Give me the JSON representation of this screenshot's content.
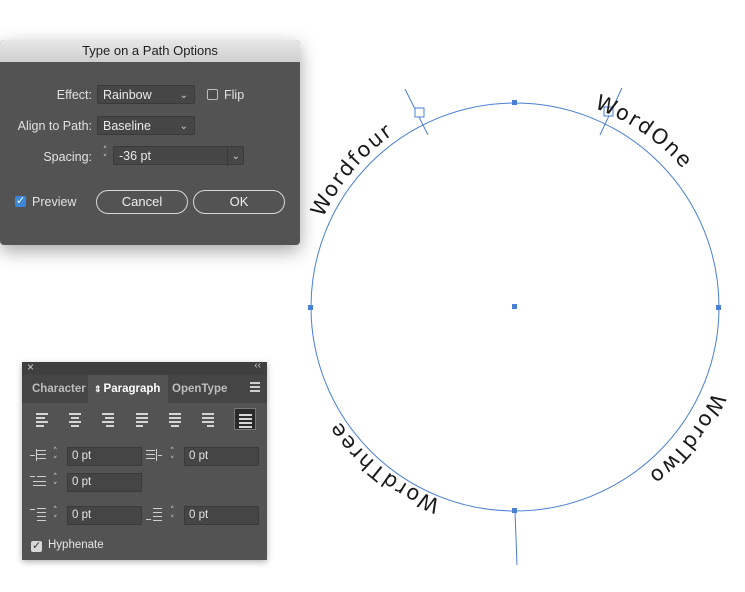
{
  "dialog": {
    "title": "Type on a Path Options",
    "effect_label": "Effect:",
    "effect_value": "Rainbow",
    "flip_label": "Flip",
    "flip_checked": false,
    "align_label": "Align to Path:",
    "align_value": "Baseline",
    "spacing_label": "Spacing:",
    "spacing_value": "-36 pt",
    "preview_label": "Preview",
    "preview_checked": true,
    "cancel_label": "Cancel",
    "ok_label": "OK"
  },
  "panel": {
    "tabs": [
      {
        "label": "Character",
        "active": false
      },
      {
        "label": "Paragraph",
        "active": true
      },
      {
        "label": "OpenType",
        "active": false
      }
    ],
    "alignment_buttons": [
      "align-left",
      "align-center",
      "align-right",
      "justify-last-left",
      "justify-last-center",
      "justify-last-right",
      "justify-all"
    ],
    "active_alignment": "justify-all",
    "left_indent": "0 pt",
    "right_indent": "0 pt",
    "first_line_indent": "0 pt",
    "space_before": "0 pt",
    "space_after": "0 pt",
    "hyphenate_label": "Hyphenate",
    "hyphenate_checked": true
  },
  "artwork": {
    "path_words": [
      "WordOne",
      "WordTwo",
      "WordThree",
      "Wordfour"
    ],
    "path_color": "#4a7fd6"
  }
}
